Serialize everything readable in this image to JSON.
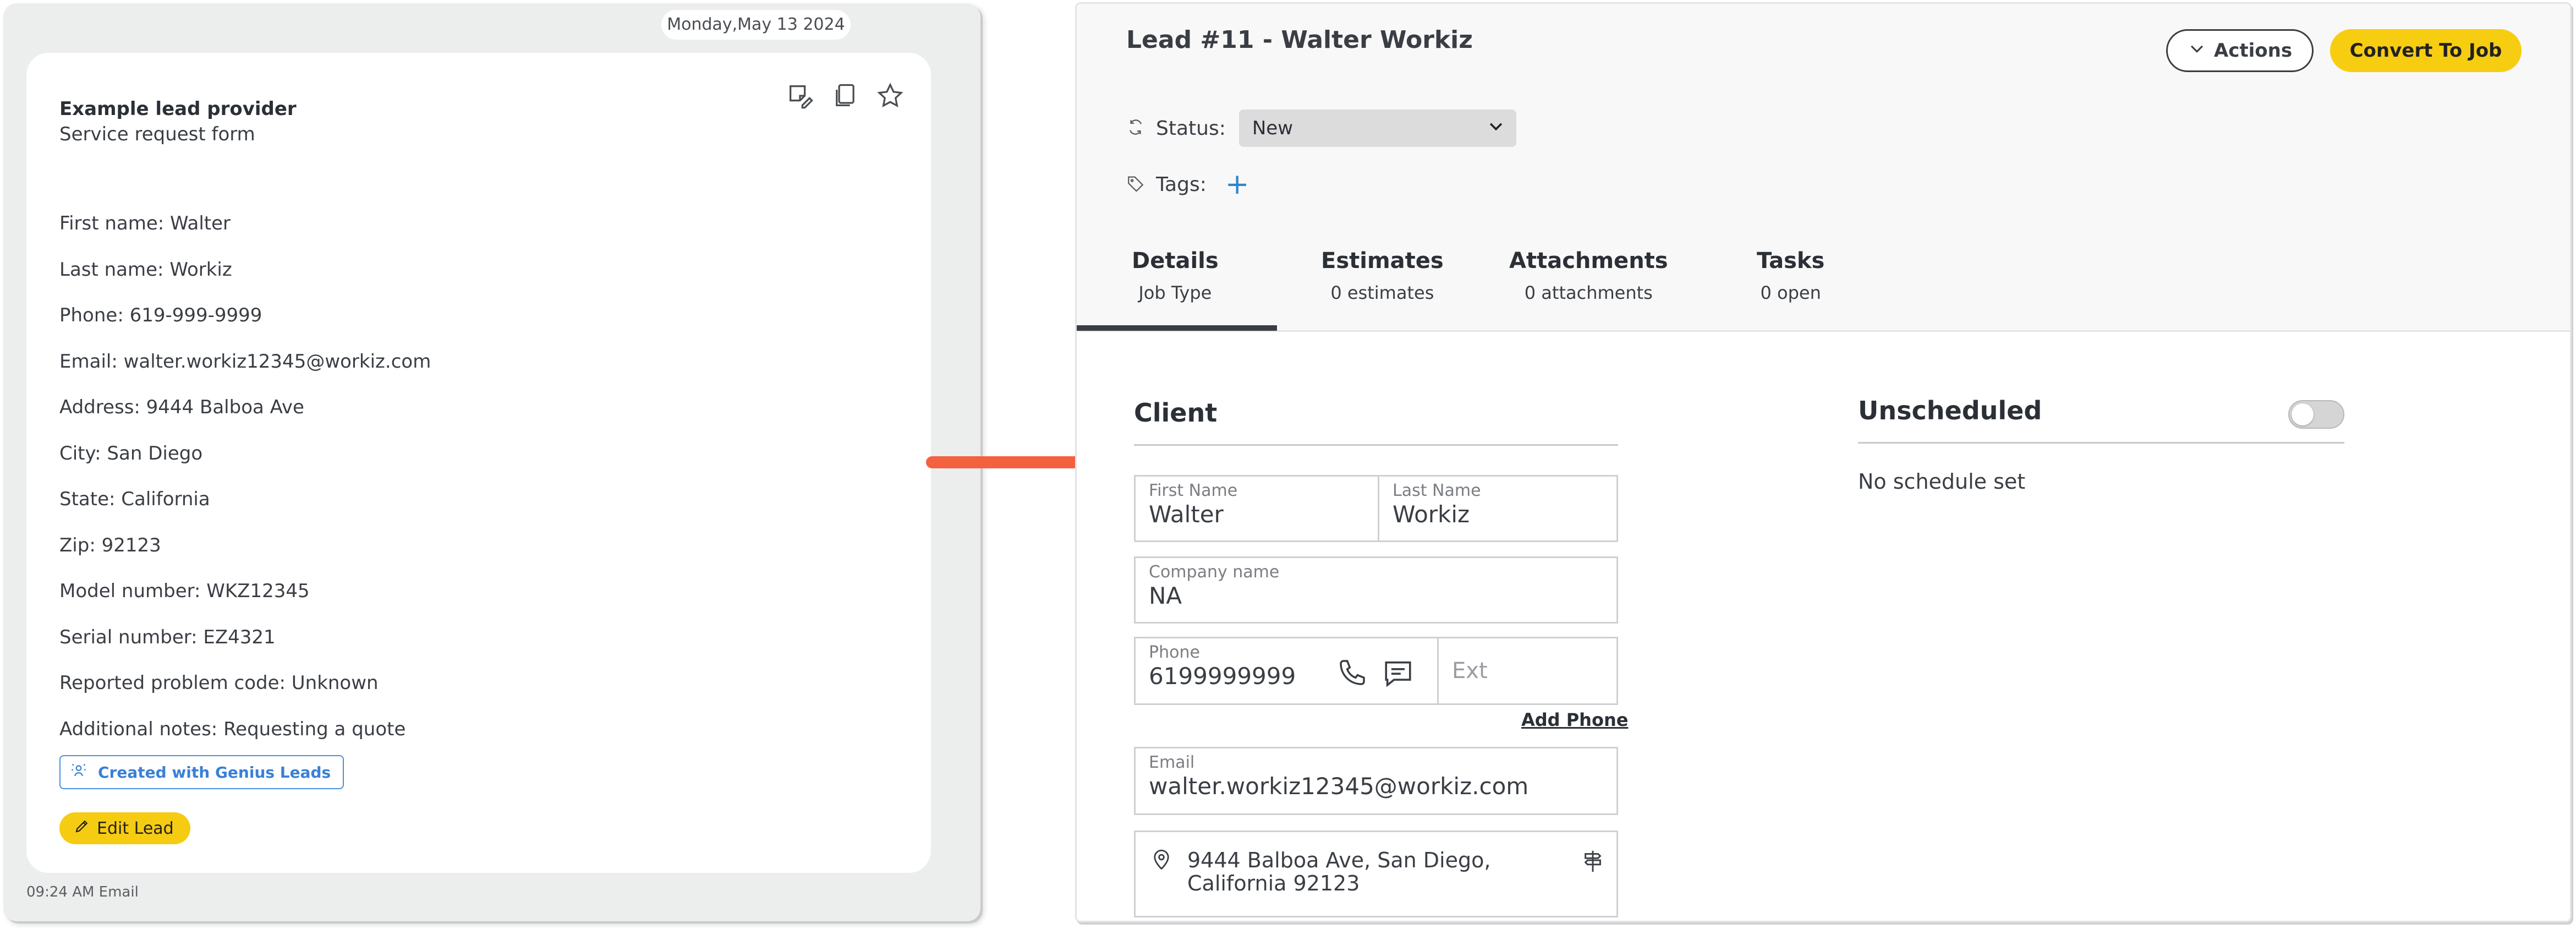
{
  "email_panel": {
    "date": "Monday,May 13 2024",
    "provider_name": "Example lead provider",
    "provider_subtitle": "Service request form",
    "fields": [
      "First name: Walter",
      "Last name: Workiz",
      "Phone: 619-999-9999",
      "Email: walter.workiz12345@workiz.com",
      "Address: 9444 Balboa Ave",
      "City: San Diego",
      "State: California",
      "Zip: 92123",
      "Model number: WKZ12345",
      "Serial number: EZ4321",
      "Reported problem code: Unknown",
      "Additional notes: Requesting a quote"
    ],
    "genius_badge": "Created with Genius Leads",
    "edit_lead_label": "Edit Lead",
    "time_source": "09:24 AM Email",
    "icons": [
      "note-edit-icon",
      "copy-icon",
      "star-icon"
    ]
  },
  "lead": {
    "title": "Lead #11 - Walter Workiz",
    "actions_label": "Actions",
    "convert_label": "Convert To Job",
    "status_label": "Status:",
    "status_value": "New",
    "tags_label": "Tags:",
    "add_tag": "+",
    "tabs": [
      {
        "label": "Details",
        "sub": "Job Type"
      },
      {
        "label": "Estimates",
        "sub": "0 estimates"
      },
      {
        "label": "Attachments",
        "sub": "0 attachments"
      },
      {
        "label": "Tasks",
        "sub": "0 open"
      }
    ],
    "client": {
      "section_title": "Client",
      "first_name_label": "First Name",
      "first_name": "Walter",
      "last_name_label": "Last Name",
      "last_name": "Workiz",
      "company_label": "Company name",
      "company": "NA",
      "phone_label": "Phone",
      "phone": "6199999999",
      "ext_placeholder": "Ext",
      "add_phone": "Add Phone",
      "email_label": "Email",
      "email": "walter.workiz12345@workiz.com",
      "address_line1": "9444 Balboa Ave, San Diego,",
      "address_line2": "California 92123"
    },
    "schedule": {
      "section_title": "Unscheduled",
      "empty_text": "No schedule set",
      "toggle_on": false
    }
  },
  "colors": {
    "accent_yellow": "#f7cd12",
    "arrow_red": "#f4613f",
    "link_blue": "#2a86d0"
  }
}
